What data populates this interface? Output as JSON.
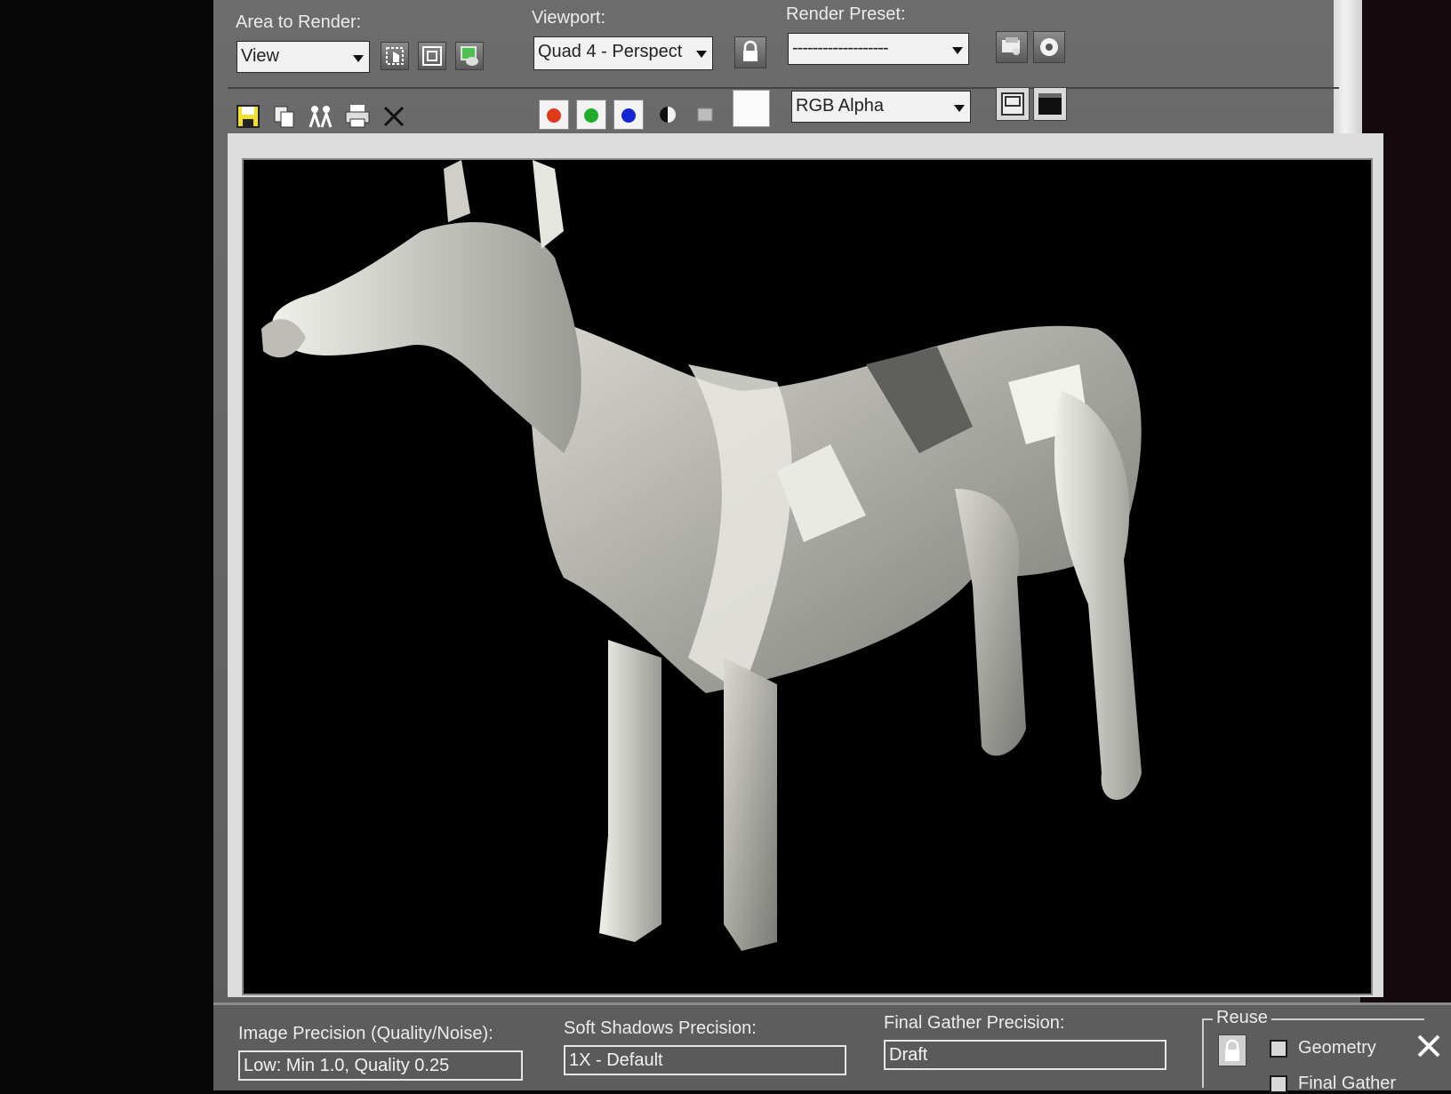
{
  "toolbar": {
    "area_to_render_label": "Area to Render:",
    "area_to_render_value": "View",
    "viewport_label": "Viewport:",
    "viewport_value": "Quad 4 - Perspect",
    "render_preset_label": "Render Preset:",
    "render_preset_value": "-------------------",
    "channel_value": "RGB Alpha"
  },
  "channels": {
    "red": "#e03a1a",
    "green": "#1fae2a",
    "blue": "#1524d8"
  },
  "icons": [
    "edit-region-icon",
    "auto-region-icon",
    "copy-render-icon",
    "lock-icon",
    "render-setup-icon",
    "environment-icon",
    "save-image-icon",
    "copy-image-icon",
    "clone-window-icon",
    "print-icon",
    "clear-icon",
    "mono-icon",
    "alpha-icon",
    "toggle-ui-icon",
    "fullscreen-icon"
  ],
  "bottom": {
    "image_precision_label": "Image Precision (Quality/Noise):",
    "image_precision_value": "Low: Min 1.0, Quality 0.25",
    "soft_shadows_label": "Soft Shadows Precision:",
    "soft_shadows_value": "1X - Default",
    "final_gather_label": "Final Gather Precision:",
    "final_gather_value": "Draft",
    "reuse_label": "Reuse",
    "geometry_label": "Geometry",
    "final_gather_reuse_label": "Final Gather"
  }
}
